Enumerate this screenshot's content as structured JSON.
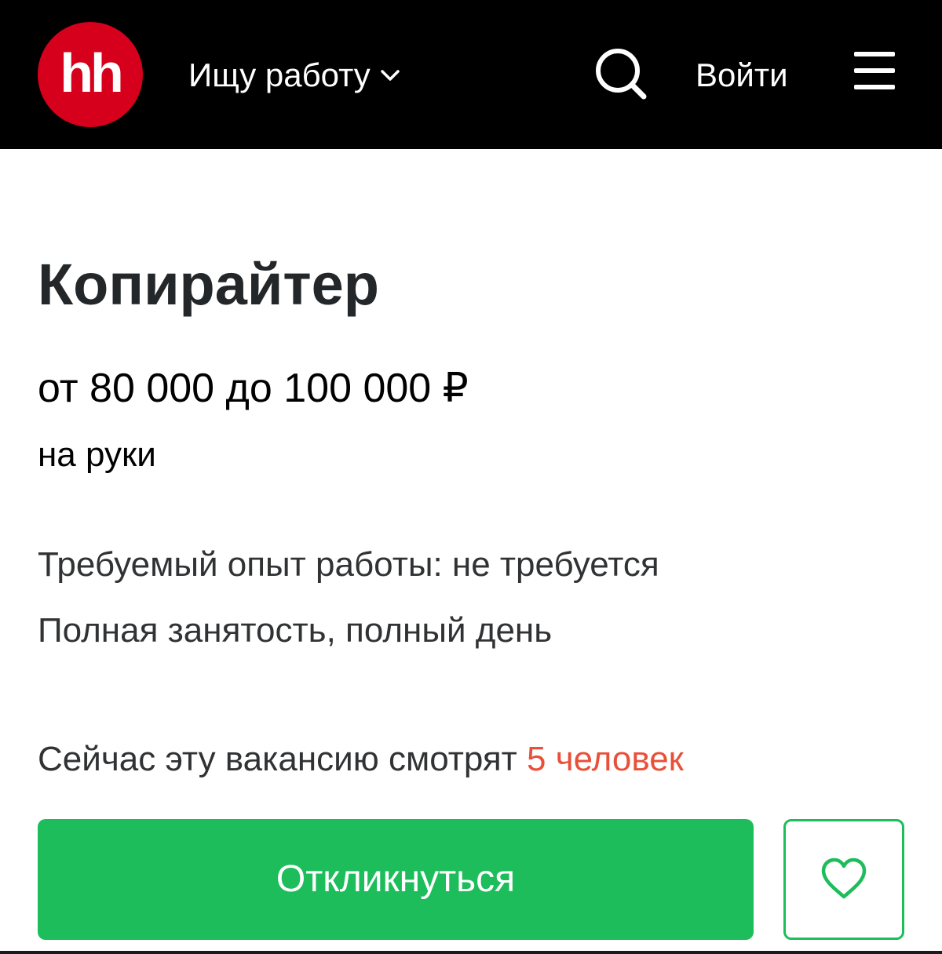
{
  "header": {
    "logo_text": "hh",
    "role_menu_label": "Ищу работу",
    "search_icon": "search-icon",
    "login_label": "Войти",
    "menu_icon": "hamburger-icon"
  },
  "vacancy": {
    "title": "Копирайтер",
    "salary": "от 80 000 до 100 000 ₽",
    "salary_note": "на руки",
    "experience": "Требуемый опыт работы: не требуется",
    "employment": "Полная занятость, полный день",
    "viewers_prefix": "Сейчас эту вакансию смотрят",
    "viewers_count": "5 человек"
  },
  "actions": {
    "apply_label": "Откликнуться",
    "favorite_icon": "heart-icon"
  },
  "colors": {
    "header_bg": "#000000",
    "logo_red": "#d6001c",
    "accent_green": "#1ebd5b",
    "viewers_highlight": "#e8503a"
  }
}
